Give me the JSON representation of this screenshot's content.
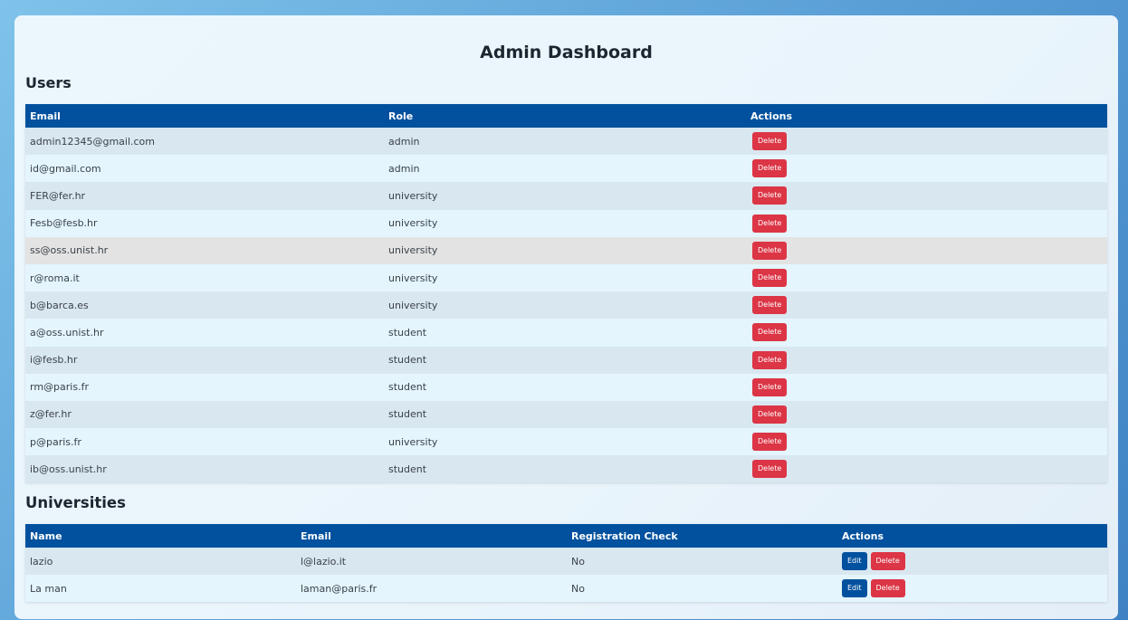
{
  "title": "Admin Dashboard",
  "users": {
    "heading": "Users",
    "columns": [
      "Email",
      "Role",
      "Actions"
    ],
    "delete_label": "Delete",
    "rows": [
      {
        "email": "admin12345@gmail.com",
        "role": "admin"
      },
      {
        "email": "id@gmail.com",
        "role": "admin"
      },
      {
        "email": "FER@fer.hr",
        "role": "university"
      },
      {
        "email": "Fesb@fesb.hr",
        "role": "university"
      },
      {
        "email": "ss@oss.unist.hr",
        "role": "university"
      },
      {
        "email": "r@roma.it",
        "role": "university"
      },
      {
        "email": "b@barca.es",
        "role": "university"
      },
      {
        "email": "a@oss.unist.hr",
        "role": "student"
      },
      {
        "email": "i@fesb.hr",
        "role": "student"
      },
      {
        "email": "rm@paris.fr",
        "role": "student"
      },
      {
        "email": "z@fer.hr",
        "role": "student"
      },
      {
        "email": "p@paris.fr",
        "role": "university"
      },
      {
        "email": "ib@oss.unist.hr",
        "role": "student"
      }
    ]
  },
  "universities": {
    "heading": "Universities",
    "columns": [
      "Name",
      "Email",
      "Registration Check",
      "Actions"
    ],
    "edit_label": "Edit",
    "delete_label": "Delete",
    "rows": [
      {
        "name": "lazio",
        "email": "l@lazio.it",
        "registration_check": "No"
      },
      {
        "name": "La man",
        "email": "laman@paris.fr",
        "registration_check": "No"
      }
    ]
  },
  "colors": {
    "header": "#02519e",
    "delete": "#dc3545",
    "edit": "#02519e"
  }
}
